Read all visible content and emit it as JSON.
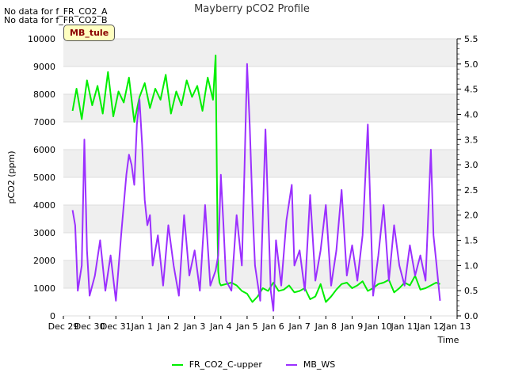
{
  "no_data_notes": [
    "No data for f_FR_CO2_A",
    "No data for f_FR_CO2_B"
  ],
  "site_badge": "MB_tule",
  "chart_data": {
    "type": "line",
    "title": "Mayberry pCO2 Profile",
    "xlabel": "Time",
    "ylabel": "pCO2 (ppm)",
    "x_tick_labels": [
      "Dec 29",
      "Dec 30",
      "Dec 31",
      "Jan 1",
      "Jan 2",
      "Jan 3",
      "Jan 4",
      "Jan 5",
      "Jan 6",
      "Jan 7",
      "Jan 8",
      "Jan 9",
      "Jan 10",
      "Jan 11",
      "Jan 12",
      "Jan 13"
    ],
    "x_range_days": [
      0,
      15
    ],
    "ylim_left": [
      0,
      10000
    ],
    "yticks_left": [
      0,
      1000,
      2000,
      3000,
      4000,
      5000,
      6000,
      7000,
      8000,
      9000,
      10000
    ],
    "ylim_right": [
      0,
      5.5
    ],
    "yticks_right": [
      "0.0",
      "0.5",
      "1.0",
      "1.5",
      "2.0",
      "2.5",
      "3.0",
      "3.5",
      "4.0",
      "4.5",
      "5.0",
      "5.5"
    ],
    "legend_position": "bottom-center",
    "background_bands": true,
    "series": [
      {
        "name": "FR_CO2_C-upper",
        "axis": "left",
        "color": "#00ee00",
        "x_days": [
          0.35,
          0.5,
          0.7,
          0.9,
          1.1,
          1.3,
          1.5,
          1.7,
          1.9,
          2.1,
          2.3,
          2.5,
          2.7,
          2.9,
          3.1,
          3.3,
          3.5,
          3.7,
          3.9,
          4.1,
          4.3,
          4.5,
          4.7,
          4.9,
          5.1,
          5.3,
          5.5,
          5.7,
          5.8,
          5.85,
          5.88,
          5.9,
          5.95,
          6.0,
          6.2,
          6.4,
          6.6,
          6.8,
          7.0,
          7.2,
          7.4,
          7.6,
          7.8,
          8.0,
          8.2,
          8.4,
          8.6,
          8.8,
          9.0,
          9.2,
          9.4,
          9.6,
          9.8,
          10.0,
          10.2,
          10.4,
          10.6,
          10.8,
          11.0,
          11.2,
          11.4,
          11.6,
          11.8,
          12.0,
          12.2,
          12.4,
          12.6,
          12.8,
          13.0,
          13.2,
          13.4,
          13.6,
          13.8,
          14.0,
          14.2,
          14.35
        ],
        "values": [
          7400,
          8200,
          7100,
          8500,
          7600,
          8300,
          7300,
          8800,
          7200,
          8100,
          7700,
          8600,
          7000,
          7900,
          8400,
          7500,
          8200,
          7800,
          8700,
          7300,
          8100,
          7600,
          8500,
          7900,
          8300,
          7400,
          8600,
          7800,
          9400,
          5000,
          2600,
          1600,
          1200,
          1100,
          1150,
          1200,
          1100,
          900,
          800,
          500,
          700,
          1000,
          900,
          1200,
          900,
          950,
          1100,
          850,
          900,
          1000,
          600,
          700,
          1150,
          500,
          700,
          950,
          1150,
          1200,
          1000,
          1100,
          1250,
          900,
          1000,
          1150,
          1200,
          1300,
          850,
          1000,
          1200,
          1100,
          1450,
          950,
          1000,
          1100,
          1200,
          1150
        ]
      },
      {
        "name": "MB_WS",
        "axis": "right",
        "color": "#9b30ff",
        "x_days": [
          0.35,
          0.45,
          0.55,
          0.7,
          0.8,
          0.9,
          1.0,
          1.2,
          1.4,
          1.6,
          1.8,
          2.0,
          2.2,
          2.4,
          2.5,
          2.6,
          2.7,
          2.8,
          2.9,
          3.0,
          3.1,
          3.2,
          3.3,
          3.4,
          3.6,
          3.8,
          4.0,
          4.2,
          4.4,
          4.6,
          4.8,
          5.0,
          5.2,
          5.4,
          5.6,
          5.8,
          5.9,
          6.0,
          6.1,
          6.2,
          6.4,
          6.6,
          6.8,
          6.9,
          7.0,
          7.1,
          7.2,
          7.3,
          7.5,
          7.7,
          7.9,
          8.0,
          8.1,
          8.3,
          8.5,
          8.7,
          8.8,
          9.0,
          9.2,
          9.4,
          9.6,
          9.8,
          10.0,
          10.2,
          10.4,
          10.6,
          10.8,
          11.0,
          11.2,
          11.4,
          11.6,
          11.8,
          12.0,
          12.2,
          12.4,
          12.6,
          12.8,
          13.0,
          13.2,
          13.4,
          13.6,
          13.8,
          14.0,
          14.1,
          14.2,
          14.35
        ],
        "values": [
          2.1,
          1.8,
          0.5,
          1.0,
          3.5,
          1.3,
          0.4,
          0.8,
          1.5,
          0.5,
          1.2,
          0.3,
          1.6,
          2.8,
          3.2,
          3.0,
          2.6,
          3.8,
          4.3,
          3.4,
          2.3,
          1.8,
          2.0,
          1.0,
          1.6,
          0.6,
          1.8,
          1.0,
          0.4,
          2.0,
          0.8,
          1.3,
          0.5,
          2.2,
          0.6,
          0.9,
          1.2,
          2.8,
          1.8,
          0.7,
          0.5,
          2.0,
          1.0,
          2.9,
          5.0,
          3.8,
          2.2,
          1.0,
          0.3,
          3.7,
          0.5,
          0.1,
          1.5,
          0.6,
          1.9,
          2.6,
          1.0,
          1.3,
          0.5,
          2.4,
          0.7,
          1.3,
          2.2,
          0.6,
          1.3,
          2.5,
          0.8,
          1.4,
          0.7,
          1.6,
          3.8,
          0.4,
          1.2,
          2.2,
          0.7,
          1.8,
          1.0,
          0.6,
          1.4,
          0.8,
          1.2,
          0.7,
          3.3,
          1.6,
          1.1,
          0.3
        ]
      }
    ]
  }
}
